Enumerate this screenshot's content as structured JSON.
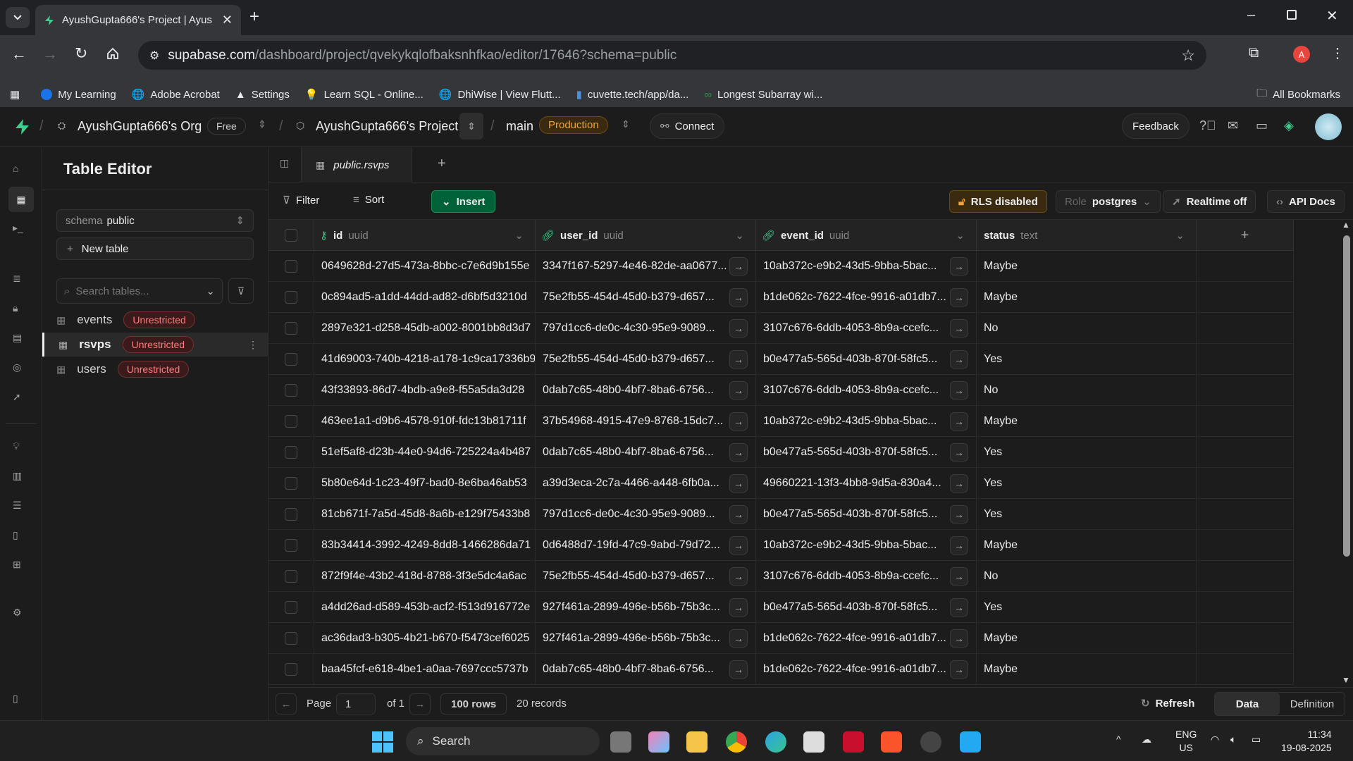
{
  "browser": {
    "tab_title": "AyushGupta666's Project | Ayus",
    "url_domain": "supabase.com",
    "url_path": "/dashboard/project/qvekykqlofbaksnhfkao/editor/17646?schema=public",
    "profile_initial": "A",
    "bookmarks": [
      "My Learning",
      "Adobe Acrobat",
      "Settings",
      "Learn SQL - Online...",
      "DhiWise | View Flutt...",
      "cuvette.tech/app/da...",
      "Longest Subarray wi..."
    ],
    "all_bookmarks": "All Bookmarks"
  },
  "header": {
    "org": "AyushGupta666's Org",
    "plan": "Free",
    "project": "AyushGupta666's Project",
    "branch": "main",
    "env": "Production",
    "connect": "Connect",
    "feedback": "Feedback"
  },
  "sidebar": {
    "title": "Table Editor",
    "schema_label": "schema",
    "schema_value": "public",
    "new_table": "New table",
    "search_placeholder": "Search tables...",
    "tables": [
      {
        "name": "events",
        "badge": "Unrestricted"
      },
      {
        "name": "rsvps",
        "badge": "Unrestricted"
      },
      {
        "name": "users",
        "badge": "Unrestricted"
      }
    ]
  },
  "editor": {
    "tab_label": "public.rsvps",
    "filter": "Filter",
    "sort": "Sort",
    "insert": "Insert",
    "rls": "RLS disabled",
    "role_label": "Role",
    "role_value": "postgres",
    "realtime": "Realtime off",
    "api_docs": "API Docs",
    "columns": [
      {
        "name": "id",
        "type": "uuid"
      },
      {
        "name": "user_id",
        "type": "uuid"
      },
      {
        "name": "event_id",
        "type": "uuid"
      },
      {
        "name": "status",
        "type": "text"
      }
    ],
    "rows": [
      [
        "0649628d-27d5-473a-8bbc-c7e6d9b155e",
        "3347f167-5297-4e46-82de-aa0677...",
        "10ab372c-e9b2-43d5-9bba-5bac...",
        "Maybe"
      ],
      [
        "0c894ad5-a1dd-44dd-ad82-d6bf5d3210d",
        "75e2fb55-454d-45d0-b379-d657...",
        "b1de062c-7622-4fce-9916-a01db7...",
        "Maybe"
      ],
      [
        "2897e321-d258-45db-a002-8001bb8d3d7",
        "797d1cc6-de0c-4c30-95e9-9089...",
        "3107c676-6ddb-4053-8b9a-ccefc...",
        "No"
      ],
      [
        "41d69003-740b-4218-a178-1c9ca17336b9",
        "75e2fb55-454d-45d0-b379-d657...",
        "b0e477a5-565d-403b-870f-58fc5...",
        "Yes"
      ],
      [
        "43f33893-86d7-4bdb-a9e8-f55a5da3d28",
        "0dab7c65-48b0-4bf7-8ba6-6756...",
        "3107c676-6ddb-4053-8b9a-ccefc...",
        "No"
      ],
      [
        "463ee1a1-d9b6-4578-910f-fdc13b81711f",
        "37b54968-4915-47e9-8768-15dc7...",
        "10ab372c-e9b2-43d5-9bba-5bac...",
        "Maybe"
      ],
      [
        "51ef5af8-d23b-44e0-94d6-725224a4b487",
        "0dab7c65-48b0-4bf7-8ba6-6756...",
        "b0e477a5-565d-403b-870f-58fc5...",
        "Yes"
      ],
      [
        "5b80e64d-1c23-49f7-bad0-8e6ba46ab53",
        "a39d3eca-2c7a-4466-a448-6fb0a...",
        "49660221-13f3-4bb8-9d5a-830a4...",
        "Yes"
      ],
      [
        "81cb671f-7a5d-45d8-8a6b-e129f75433b8",
        "797d1cc6-de0c-4c30-95e9-9089...",
        "b0e477a5-565d-403b-870f-58fc5...",
        "Yes"
      ],
      [
        "83b34414-3992-4249-8dd8-1466286da71",
        "0d6488d7-19fd-47c9-9abd-79d72...",
        "10ab372c-e9b2-43d5-9bba-5bac...",
        "Maybe"
      ],
      [
        "872f9f4e-43b2-418d-8788-3f3e5dc4a6ac",
        "75e2fb55-454d-45d0-b379-d657...",
        "3107c676-6ddb-4053-8b9a-ccefc...",
        "No"
      ],
      [
        "a4dd26ad-d589-453b-acf2-f513d916772e",
        "927f461a-2899-496e-b56b-75b3c...",
        "b0e477a5-565d-403b-870f-58fc5...",
        "Yes"
      ],
      [
        "ac36dad3-b305-4b21-b670-f5473cef6025",
        "927f461a-2899-496e-b56b-75b3c...",
        "b1de062c-7622-4fce-9916-a01db7...",
        "Maybe"
      ],
      [
        "baa45fcf-e618-4be1-a0aa-7697ccc5737b",
        "0dab7c65-48b0-4bf7-8ba6-6756...",
        "b1de062c-7622-4fce-9916-a01db7...",
        "Maybe"
      ]
    ]
  },
  "footer": {
    "page_label": "Page",
    "page_value": "1",
    "of": "of 1",
    "rows": "100 rows",
    "records": "20 records",
    "refresh": "Refresh",
    "data_tab": "Data",
    "definition_tab": "Definition"
  },
  "taskbar": {
    "search": "Search",
    "lang1": "ENG",
    "lang2": "US",
    "time": "11:34",
    "date": "19-08-2025"
  },
  "colors": {
    "accent": "#3ecf8e",
    "insert_bg": "#006239",
    "warning": "#f2a33a",
    "danger": "#ff7b7b"
  }
}
